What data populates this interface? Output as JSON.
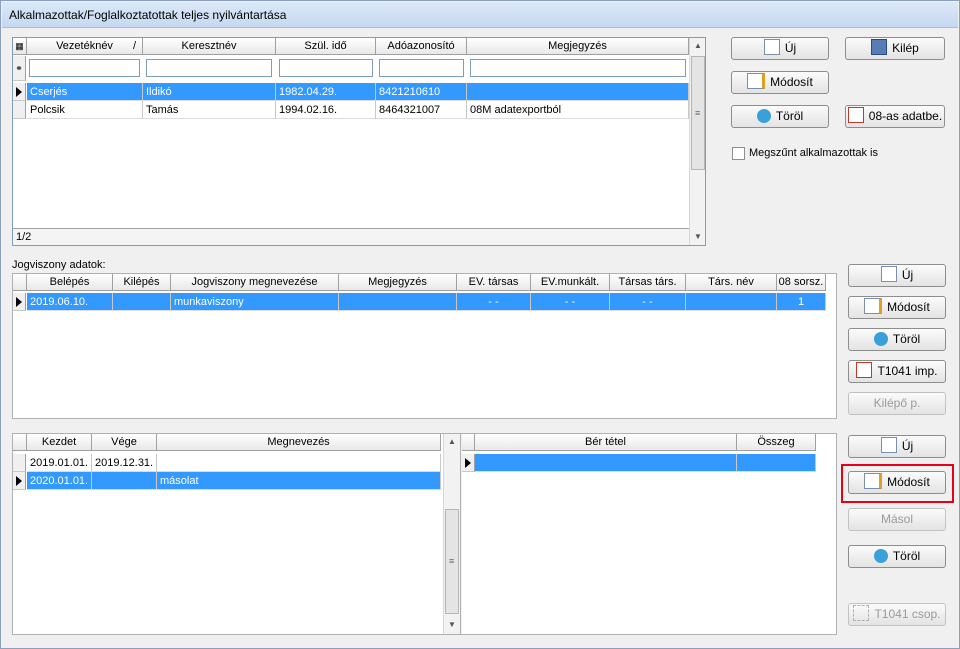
{
  "window": {
    "title": "Alkalmazottak/Foglalkoztatottak teljes nyilvántartása"
  },
  "employees": {
    "columns": [
      "Vezetéknév",
      "Keresztnév",
      "Szül. idő",
      "Adóazonosító",
      "Megjegyzés"
    ],
    "sort_marker": "/",
    "rows": [
      {
        "vezeteknev": "Cserjés",
        "keresztnev": "Ildikó",
        "szul": "1982.04.29.",
        "ado": "8421210610",
        "megj": ""
      },
      {
        "vezeteknev": "Polcsik",
        "keresztnev": "Tamás",
        "szul": "1994.02.16.",
        "ado": "8464321007",
        "megj": "08M adatexportból"
      }
    ],
    "record_count": "1/2"
  },
  "top_buttons": {
    "new": "Új",
    "exit": "Kilép",
    "modify": "Módosít",
    "delete": "Töröl",
    "import08": "08-as adatbe."
  },
  "checkbox": {
    "label": "Megszűnt alkalmazottak is",
    "checked": false
  },
  "jogviszony": {
    "label": "Jogviszony adatok:",
    "columns": [
      "Belépés",
      "Kilépés",
      "Jogviszony megnevezése",
      "Megjegyzés",
      "EV. társas",
      "EV.munkált.",
      "Társas társ.",
      "Társ. név",
      "08 sorsz."
    ],
    "rows": [
      {
        "belepes": "2019.06.10.",
        "kilepes": "",
        "megnevezes": "munkaviszony",
        "megj": "",
        "ev_tarsas": "- -",
        "ev_munkalt": "- -",
        "tarsas_tars": "- -",
        "tars_nev": "",
        "sorsz": "1"
      }
    ]
  },
  "mid_buttons": {
    "new": "Új",
    "modify": "Módosít",
    "delete": "Töröl",
    "t1041imp": "T1041 imp.",
    "kilepo": "Kilépő p."
  },
  "periods": {
    "columns": [
      "Kezdet",
      "Vége",
      "Megnevezés"
    ],
    "rows": [
      {
        "kezdet": "2019.01.01.",
        "vege": "2019.12.31.",
        "megn": ""
      },
      {
        "kezdet": "2020.01.01.",
        "vege": "",
        "megn": "másolat"
      }
    ]
  },
  "ber": {
    "columns": [
      "Bér tétel",
      "Összeg"
    ]
  },
  "bottom_buttons": {
    "new": "Új",
    "modify": "Módosít",
    "copy": "Másol",
    "delete": "Töröl",
    "t1041csop": "T1041 csop."
  },
  "colors": {
    "selection": "#3399ff",
    "highlight": "#e8001b"
  }
}
